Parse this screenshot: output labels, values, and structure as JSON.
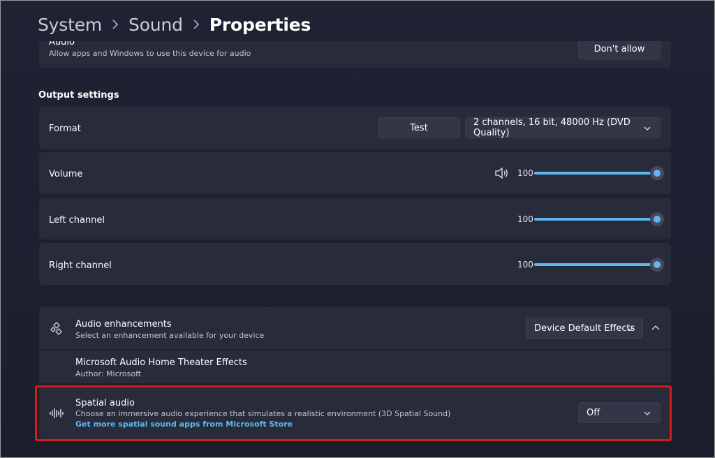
{
  "breadcrumb": {
    "items": [
      "System",
      "Sound"
    ],
    "current": "Properties"
  },
  "audio_row": {
    "label": "Audio",
    "sub": "Allow apps and Windows to use this device for audio",
    "button": "Don't allow"
  },
  "output_settings": {
    "title": "Output settings",
    "format": {
      "label": "Format",
      "test_button": "Test",
      "value": "2 channels, 16 bit, 48000 Hz (DVD Quality)"
    },
    "volume": {
      "label": "Volume",
      "value": "100"
    },
    "left_channel": {
      "label": "Left channel",
      "value": "100"
    },
    "right_channel": {
      "label": "Right channel",
      "value": "100"
    }
  },
  "enhancements": {
    "title": "Audio enhancements",
    "sub": "Select an enhancement available for your device",
    "dropdown": "Device Default Effects",
    "effect_name": "Microsoft Audio Home Theater Effects",
    "effect_author": "Author: Microsoft"
  },
  "spatial": {
    "title": "Spatial audio",
    "sub": "Choose an immersive audio experience that simulates a realistic environment (3D Spatial Sound)",
    "link": "Get more spatial sound apps from Microsoft Store",
    "dropdown": "Off"
  },
  "colors": {
    "accent": "#5fb7f2",
    "highlight": "#d41b1b",
    "card": "#272b3a",
    "background": "#1c2030"
  }
}
